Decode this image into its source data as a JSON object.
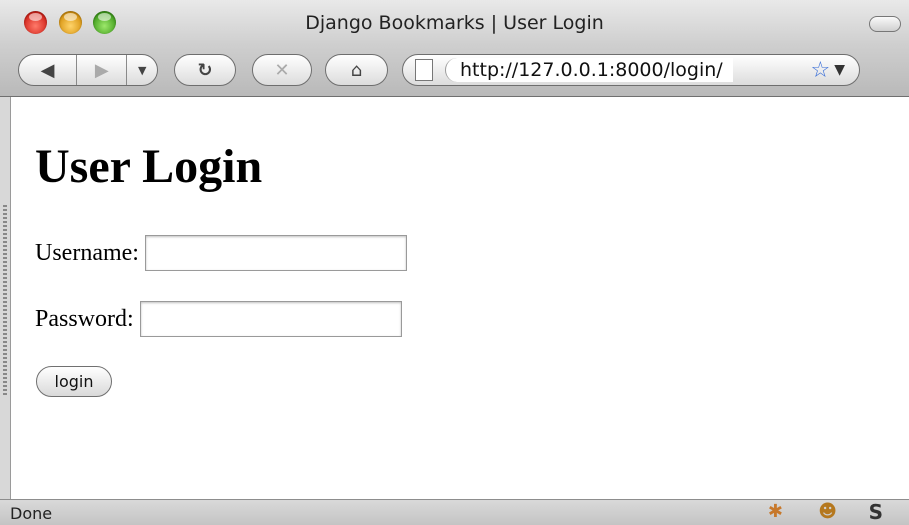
{
  "window": {
    "title": "Django Bookmarks | User Login"
  },
  "toolbar": {
    "url": "http://127.0.0.1:8000/login/",
    "icons": [
      "back-icon",
      "forward-icon",
      "history-dropdown-icon",
      "reload-icon",
      "stop-icon",
      "home-icon",
      "page-icon",
      "bookmark-star-icon",
      "url-dropdown-icon"
    ]
  },
  "page": {
    "heading": "User Login",
    "username_label": "Username:",
    "username_value": "",
    "password_label": "Password:",
    "password_value": "",
    "login_button": "login"
  },
  "status": {
    "text": "Done",
    "icons": [
      "firebug-icon",
      "greasemonkey-icon",
      "s-icon"
    ]
  }
}
